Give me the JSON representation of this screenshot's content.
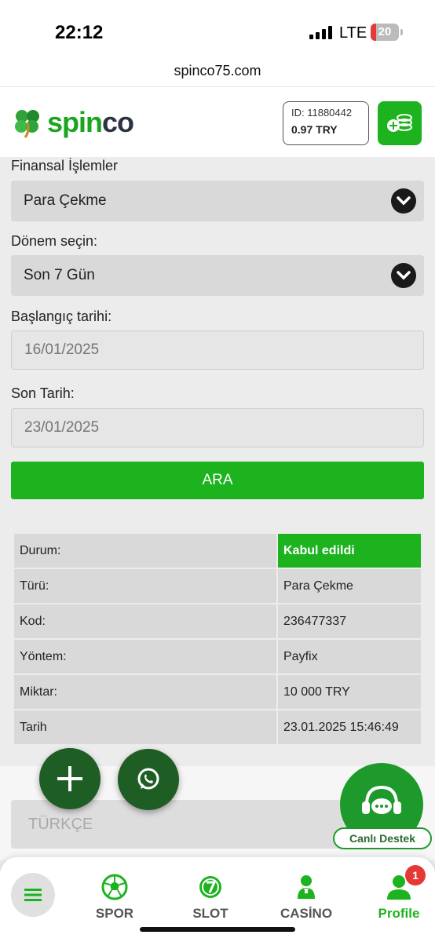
{
  "status_bar": {
    "time": "22:12",
    "network": "LTE",
    "battery": "20",
    "battery_level_percent": 20
  },
  "browser": {
    "url": "spinco75.com"
  },
  "header": {
    "brand_part1": "spin",
    "brand_part2": "co",
    "user_id": "ID: 11880442",
    "balance": "0.97 TRY"
  },
  "form": {
    "transactions_label": "Finansal İşlemler",
    "transaction_type": "Para Çekme",
    "period_label": "Dönem seçin:",
    "period_value": "Son 7 Gün",
    "start_label": "Başlangıç tarihi:",
    "start_placeholder": "16/01/2025",
    "end_label": "Son Tarih:",
    "end_placeholder": "23/01/2025",
    "search_button": "ARA"
  },
  "result": {
    "rows": [
      {
        "key": "Durum:",
        "value": "Kabul edildi"
      },
      {
        "key": "Türü:",
        "value": "Para Çekme"
      },
      {
        "key": "Kod:",
        "value": "236477337"
      },
      {
        "key": "Yöntem:",
        "value": "Payfix"
      },
      {
        "key": "Miktar:",
        "value": "10 000 TRY"
      },
      {
        "key": "Tarih",
        "value": "23.01.2025 15:46:49"
      }
    ]
  },
  "language": {
    "label": "TÜRKÇE"
  },
  "support": {
    "label": "Canlı Destek"
  },
  "colors": {
    "accent": "#1db31f",
    "dark_green": "#1e5e24",
    "badge": "#e53935"
  },
  "bottom_nav": {
    "items": [
      {
        "label": "SPOR",
        "icon": "soccer-ball-icon"
      },
      {
        "label": "SLOT",
        "icon": "slot-seven-icon"
      },
      {
        "label": "CASİNO",
        "icon": "dealer-icon"
      },
      {
        "label": "Profile",
        "icon": "profile-icon",
        "badge": "1"
      }
    ]
  }
}
